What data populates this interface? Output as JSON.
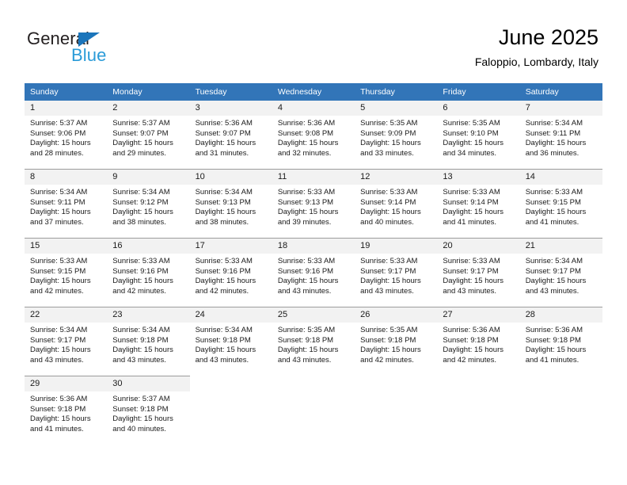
{
  "brand": {
    "name_top": "General",
    "name_bottom": "Blue",
    "triangle_color": "#1b75bb",
    "blue_text_color": "#2a9bd8"
  },
  "header": {
    "title": "June 2025",
    "subtitle": "Faloppio, Lombardy, Italy"
  },
  "theme": {
    "header_row_bg": "#3275b8",
    "daynum_bg": "#f2f2f2",
    "grid_line": "#9c9c9c"
  },
  "weekday_headers": [
    "Sunday",
    "Monday",
    "Tuesday",
    "Wednesday",
    "Thursday",
    "Friday",
    "Saturday"
  ],
  "weeks": [
    [
      {
        "day": "1",
        "sunrise": "Sunrise: 5:37 AM",
        "sunset": "Sunset: 9:06 PM",
        "daylight_line1": "Daylight: 15 hours",
        "daylight_line2": "and 28 minutes."
      },
      {
        "day": "2",
        "sunrise": "Sunrise: 5:37 AM",
        "sunset": "Sunset: 9:07 PM",
        "daylight_line1": "Daylight: 15 hours",
        "daylight_line2": "and 29 minutes."
      },
      {
        "day": "3",
        "sunrise": "Sunrise: 5:36 AM",
        "sunset": "Sunset: 9:07 PM",
        "daylight_line1": "Daylight: 15 hours",
        "daylight_line2": "and 31 minutes."
      },
      {
        "day": "4",
        "sunrise": "Sunrise: 5:36 AM",
        "sunset": "Sunset: 9:08 PM",
        "daylight_line1": "Daylight: 15 hours",
        "daylight_line2": "and 32 minutes."
      },
      {
        "day": "5",
        "sunrise": "Sunrise: 5:35 AM",
        "sunset": "Sunset: 9:09 PM",
        "daylight_line1": "Daylight: 15 hours",
        "daylight_line2": "and 33 minutes."
      },
      {
        "day": "6",
        "sunrise": "Sunrise: 5:35 AM",
        "sunset": "Sunset: 9:10 PM",
        "daylight_line1": "Daylight: 15 hours",
        "daylight_line2": "and 34 minutes."
      },
      {
        "day": "7",
        "sunrise": "Sunrise: 5:34 AM",
        "sunset": "Sunset: 9:11 PM",
        "daylight_line1": "Daylight: 15 hours",
        "daylight_line2": "and 36 minutes."
      }
    ],
    [
      {
        "day": "8",
        "sunrise": "Sunrise: 5:34 AM",
        "sunset": "Sunset: 9:11 PM",
        "daylight_line1": "Daylight: 15 hours",
        "daylight_line2": "and 37 minutes."
      },
      {
        "day": "9",
        "sunrise": "Sunrise: 5:34 AM",
        "sunset": "Sunset: 9:12 PM",
        "daylight_line1": "Daylight: 15 hours",
        "daylight_line2": "and 38 minutes."
      },
      {
        "day": "10",
        "sunrise": "Sunrise: 5:34 AM",
        "sunset": "Sunset: 9:13 PM",
        "daylight_line1": "Daylight: 15 hours",
        "daylight_line2": "and 38 minutes."
      },
      {
        "day": "11",
        "sunrise": "Sunrise: 5:33 AM",
        "sunset": "Sunset: 9:13 PM",
        "daylight_line1": "Daylight: 15 hours",
        "daylight_line2": "and 39 minutes."
      },
      {
        "day": "12",
        "sunrise": "Sunrise: 5:33 AM",
        "sunset": "Sunset: 9:14 PM",
        "daylight_line1": "Daylight: 15 hours",
        "daylight_line2": "and 40 minutes."
      },
      {
        "day": "13",
        "sunrise": "Sunrise: 5:33 AM",
        "sunset": "Sunset: 9:14 PM",
        "daylight_line1": "Daylight: 15 hours",
        "daylight_line2": "and 41 minutes."
      },
      {
        "day": "14",
        "sunrise": "Sunrise: 5:33 AM",
        "sunset": "Sunset: 9:15 PM",
        "daylight_line1": "Daylight: 15 hours",
        "daylight_line2": "and 41 minutes."
      }
    ],
    [
      {
        "day": "15",
        "sunrise": "Sunrise: 5:33 AM",
        "sunset": "Sunset: 9:15 PM",
        "daylight_line1": "Daylight: 15 hours",
        "daylight_line2": "and 42 minutes."
      },
      {
        "day": "16",
        "sunrise": "Sunrise: 5:33 AM",
        "sunset": "Sunset: 9:16 PM",
        "daylight_line1": "Daylight: 15 hours",
        "daylight_line2": "and 42 minutes."
      },
      {
        "day": "17",
        "sunrise": "Sunrise: 5:33 AM",
        "sunset": "Sunset: 9:16 PM",
        "daylight_line1": "Daylight: 15 hours",
        "daylight_line2": "and 42 minutes."
      },
      {
        "day": "18",
        "sunrise": "Sunrise: 5:33 AM",
        "sunset": "Sunset: 9:16 PM",
        "daylight_line1": "Daylight: 15 hours",
        "daylight_line2": "and 43 minutes."
      },
      {
        "day": "19",
        "sunrise": "Sunrise: 5:33 AM",
        "sunset": "Sunset: 9:17 PM",
        "daylight_line1": "Daylight: 15 hours",
        "daylight_line2": "and 43 minutes."
      },
      {
        "day": "20",
        "sunrise": "Sunrise: 5:33 AM",
        "sunset": "Sunset: 9:17 PM",
        "daylight_line1": "Daylight: 15 hours",
        "daylight_line2": "and 43 minutes."
      },
      {
        "day": "21",
        "sunrise": "Sunrise: 5:34 AM",
        "sunset": "Sunset: 9:17 PM",
        "daylight_line1": "Daylight: 15 hours",
        "daylight_line2": "and 43 minutes."
      }
    ],
    [
      {
        "day": "22",
        "sunrise": "Sunrise: 5:34 AM",
        "sunset": "Sunset: 9:17 PM",
        "daylight_line1": "Daylight: 15 hours",
        "daylight_line2": "and 43 minutes."
      },
      {
        "day": "23",
        "sunrise": "Sunrise: 5:34 AM",
        "sunset": "Sunset: 9:18 PM",
        "daylight_line1": "Daylight: 15 hours",
        "daylight_line2": "and 43 minutes."
      },
      {
        "day": "24",
        "sunrise": "Sunrise: 5:34 AM",
        "sunset": "Sunset: 9:18 PM",
        "daylight_line1": "Daylight: 15 hours",
        "daylight_line2": "and 43 minutes."
      },
      {
        "day": "25",
        "sunrise": "Sunrise: 5:35 AM",
        "sunset": "Sunset: 9:18 PM",
        "daylight_line1": "Daylight: 15 hours",
        "daylight_line2": "and 43 minutes."
      },
      {
        "day": "26",
        "sunrise": "Sunrise: 5:35 AM",
        "sunset": "Sunset: 9:18 PM",
        "daylight_line1": "Daylight: 15 hours",
        "daylight_line2": "and 42 minutes."
      },
      {
        "day": "27",
        "sunrise": "Sunrise: 5:36 AM",
        "sunset": "Sunset: 9:18 PM",
        "daylight_line1": "Daylight: 15 hours",
        "daylight_line2": "and 42 minutes."
      },
      {
        "day": "28",
        "sunrise": "Sunrise: 5:36 AM",
        "sunset": "Sunset: 9:18 PM",
        "daylight_line1": "Daylight: 15 hours",
        "daylight_line2": "and 41 minutes."
      }
    ],
    [
      {
        "day": "29",
        "sunrise": "Sunrise: 5:36 AM",
        "sunset": "Sunset: 9:18 PM",
        "daylight_line1": "Daylight: 15 hours",
        "daylight_line2": "and 41 minutes."
      },
      {
        "day": "30",
        "sunrise": "Sunrise: 5:37 AM",
        "sunset": "Sunset: 9:18 PM",
        "daylight_line1": "Daylight: 15 hours",
        "daylight_line2": "and 40 minutes."
      },
      {
        "day": "",
        "sunrise": "",
        "sunset": "",
        "daylight_line1": "",
        "daylight_line2": ""
      },
      {
        "day": "",
        "sunrise": "",
        "sunset": "",
        "daylight_line1": "",
        "daylight_line2": ""
      },
      {
        "day": "",
        "sunrise": "",
        "sunset": "",
        "daylight_line1": "",
        "daylight_line2": ""
      },
      {
        "day": "",
        "sunrise": "",
        "sunset": "",
        "daylight_line1": "",
        "daylight_line2": ""
      },
      {
        "day": "",
        "sunrise": "",
        "sunset": "",
        "daylight_line1": "",
        "daylight_line2": ""
      }
    ]
  ]
}
